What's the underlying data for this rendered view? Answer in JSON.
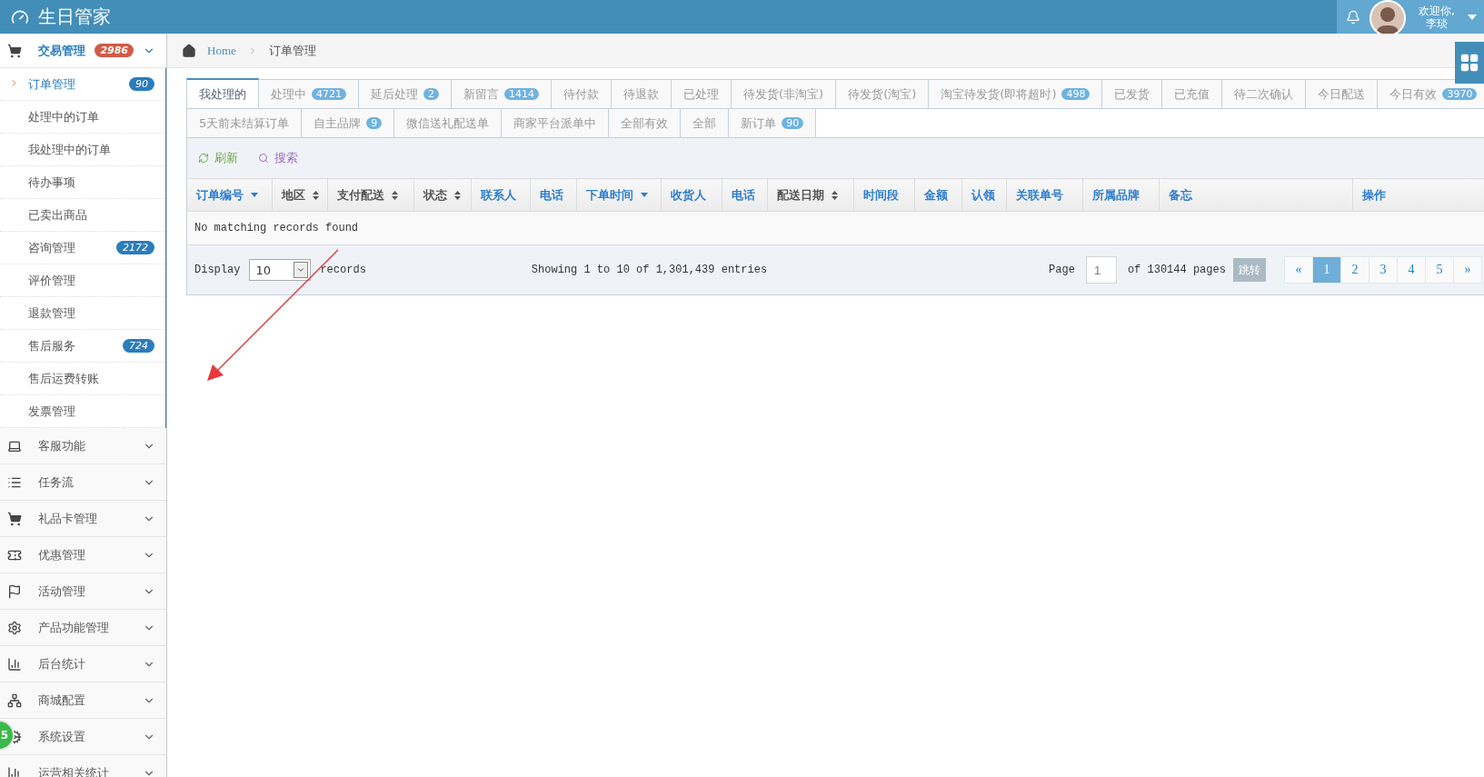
{
  "header": {
    "title": "生日管家",
    "welcome": "欢迎你,",
    "user": "李琰"
  },
  "sidebar": {
    "groups": [
      {
        "kind": "cart",
        "label": "交易管理",
        "badge": "2986",
        "expanded": true,
        "children": [
          {
            "label": "订单管理",
            "badge": "90",
            "selected": true
          },
          {
            "label": "处理中的订单",
            "selected": false
          },
          {
            "label": "我处理中的订单",
            "selected": false
          },
          {
            "label": "待办事项",
            "selected": false
          },
          {
            "label": "已卖出商品",
            "selected": false
          },
          {
            "label": "咨询管理",
            "badge": "2172",
            "selected": false
          },
          {
            "label": "评价管理",
            "selected": false
          },
          {
            "label": "退款管理",
            "selected": false
          },
          {
            "label": "售后服务",
            "badge": "724",
            "selected": false
          },
          {
            "label": "售后运费转账",
            "selected": false
          },
          {
            "label": "发票管理",
            "selected": false
          }
        ]
      },
      {
        "kind": "laptop",
        "label": "客服功能",
        "expanded": false
      },
      {
        "kind": "list",
        "label": "任务流",
        "expanded": false
      },
      {
        "kind": "cart",
        "label": "礼品卡管理",
        "expanded": false
      },
      {
        "kind": "ticket",
        "label": "优惠管理",
        "expanded": false
      },
      {
        "kind": "flag",
        "label": "活动管理",
        "expanded": false
      },
      {
        "kind": "gear",
        "label": "产品功能管理",
        "expanded": false
      },
      {
        "kind": "chart",
        "label": "后台统计",
        "expanded": false
      },
      {
        "kind": "sitemap",
        "label": "商城配置",
        "expanded": false
      },
      {
        "kind": "gears",
        "label": "系统设置",
        "expanded": false
      },
      {
        "kind": "chart",
        "label": "运营相关统计",
        "expanded": false
      }
    ]
  },
  "floating_badge": "5",
  "breadcrumb": [
    "Home",
    "订单管理"
  ],
  "tab_rows": [
    {
      "tabs": [
        {
          "label": "我处理的",
          "selected": true
        },
        {
          "label": "处理中",
          "badge": "4721",
          "selected": false
        },
        {
          "label": "延后处理",
          "badge": "2",
          "selected": false
        },
        {
          "label": "新留言",
          "badge": "1414",
          "selected": false
        },
        {
          "label": "待付款",
          "selected": false
        },
        {
          "label": "待退款",
          "selected": false
        },
        {
          "label": "已处理",
          "selected": false
        },
        {
          "label": "待发货(非淘宝)",
          "selected": false
        },
        {
          "label": "待发货(淘宝)",
          "selected": false
        },
        {
          "label": "淘宝待发货(即将超时)",
          "badge": "498",
          "selected": false
        },
        {
          "label": "已发货",
          "selected": false
        },
        {
          "label": "已充值",
          "selected": false
        },
        {
          "label": "待二次确认",
          "selected": false
        },
        {
          "label": "今日配送",
          "selected": false
        },
        {
          "label": "今日有效",
          "badge": "3970",
          "selected": false
        }
      ]
    },
    {
      "tabs": [
        {
          "label": "5天前未结算订单",
          "selected": false
        },
        {
          "label": "自主品牌",
          "badge": "9",
          "selected": false
        },
        {
          "label": "微信送礼配送单",
          "selected": false
        },
        {
          "label": "商家平台派单中",
          "selected": false
        },
        {
          "label": "全部有效",
          "selected": false
        },
        {
          "label": "全部",
          "selected": false
        },
        {
          "label": "新订单",
          "badge": "90",
          "selected": false
        }
      ]
    }
  ],
  "toolbar": [
    {
      "kind": "refresh",
      "label": "刷新"
    },
    {
      "kind": "search",
      "label": "搜索"
    }
  ],
  "table": {
    "columns": [
      {
        "label": "订单编号",
        "kind": "desc"
      },
      {
        "label": "地区",
        "kind": "both"
      },
      {
        "label": "支付配送",
        "kind": "both"
      },
      {
        "label": "状态",
        "kind": "both"
      },
      {
        "label": "联系人",
        "kind": "plain"
      },
      {
        "label": "电话",
        "kind": "plain"
      },
      {
        "label": "下单时间",
        "kind": "desc"
      },
      {
        "label": "收货人",
        "kind": "plain"
      },
      {
        "label": "电话",
        "kind": "plain"
      },
      {
        "label": "配送日期",
        "kind": "both"
      },
      {
        "label": "时间段",
        "kind": "plain"
      },
      {
        "label": "金额",
        "kind": "plain"
      },
      {
        "label": "认领",
        "kind": "plain"
      },
      {
        "label": "关联单号",
        "kind": "plain"
      },
      {
        "label": "所属品牌",
        "kind": "plain"
      },
      {
        "label": "备忘",
        "kind": "plain"
      },
      {
        "label": "操作",
        "kind": "plain"
      }
    ],
    "empty_message": "No matching records found"
  },
  "footer": {
    "display_label": "Display",
    "page_size": "10",
    "records_label": "records",
    "showing": "Showing 1 to 10 of 1,301,439 entries",
    "page_label": "Page",
    "page_value": "1",
    "of_pages": "of 130144 pages",
    "jump_button": "跳转",
    "pages": [
      {
        "label": "«",
        "selected": false
      },
      {
        "label": "1",
        "selected": true
      },
      {
        "label": "2",
        "selected": false
      },
      {
        "label": "3",
        "selected": false
      },
      {
        "label": "4",
        "selected": false
      },
      {
        "label": "5",
        "selected": false
      },
      {
        "label": "»",
        "selected": false
      }
    ]
  }
}
